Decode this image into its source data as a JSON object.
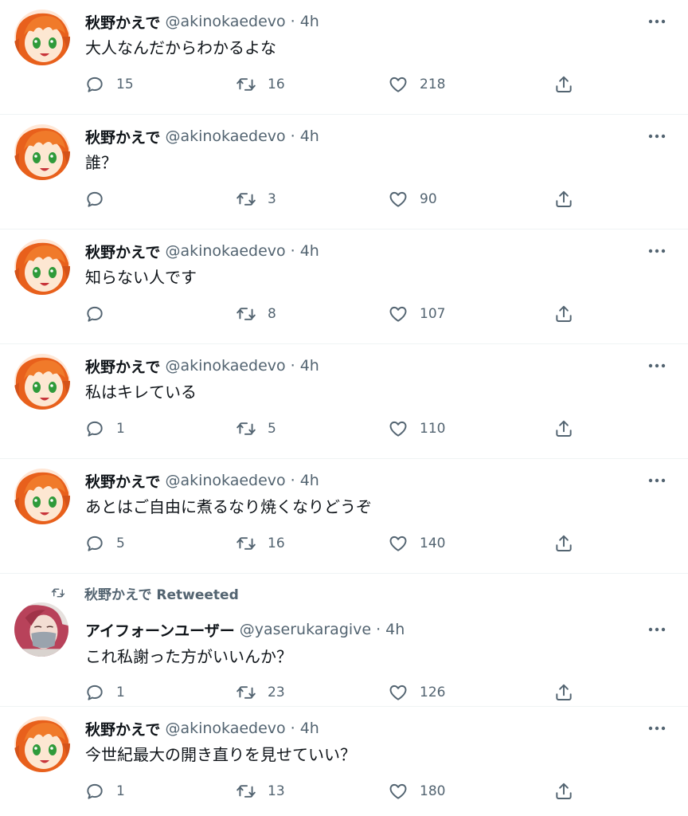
{
  "icons": {
    "reply": "reply-icon",
    "retweet": "retweet-icon",
    "like": "heart-icon",
    "share": "share-icon",
    "more": "more-icon"
  },
  "colors": {
    "text_primary": "#0f1419",
    "text_secondary": "#536471",
    "divider": "#eff3f4"
  },
  "tweets": [
    {
      "name": "秋野かえで",
      "handle": "@akinokaedevo",
      "separator": "·",
      "time": "4h",
      "text": "大人なんだからわかるよな",
      "replies": "15",
      "retweets": "16",
      "likes": "218"
    },
    {
      "name": "秋野かえで",
      "handle": "@akinokaedevo",
      "separator": "·",
      "time": "4h",
      "text": "誰？",
      "replies": "",
      "retweets": "3",
      "likes": "90"
    },
    {
      "name": "秋野かえで",
      "handle": "@akinokaedevo",
      "separator": "·",
      "time": "4h",
      "text": "知らない人です",
      "replies": "",
      "retweets": "8",
      "likes": "107"
    },
    {
      "name": "秋野かえで",
      "handle": "@akinokaedevo",
      "separator": "·",
      "time": "4h",
      "text": "私はキレている",
      "replies": "1",
      "retweets": "5",
      "likes": "110"
    },
    {
      "name": "秋野かえで",
      "handle": "@akinokaedevo",
      "separator": "·",
      "time": "4h",
      "text": "あとはご自由に煮るなり焼くなりどうぞ",
      "replies": "5",
      "retweets": "16",
      "likes": "140"
    },
    {
      "social_context": "秋野かえで Retweeted",
      "name": "アイフォーンユーザー",
      "handle": "@yaserukaragive",
      "separator": "·",
      "time": "4h",
      "text": "これ私謝った方がいいんか？",
      "replies": "1",
      "retweets": "23",
      "likes": "126"
    },
    {
      "name": "秋野かえで",
      "handle": "@akinokaedevo",
      "separator": "·",
      "time": "4h",
      "text": "今世紀最大の開き直りを見せていい？",
      "replies": "1",
      "retweets": "13",
      "likes": "180"
    }
  ]
}
